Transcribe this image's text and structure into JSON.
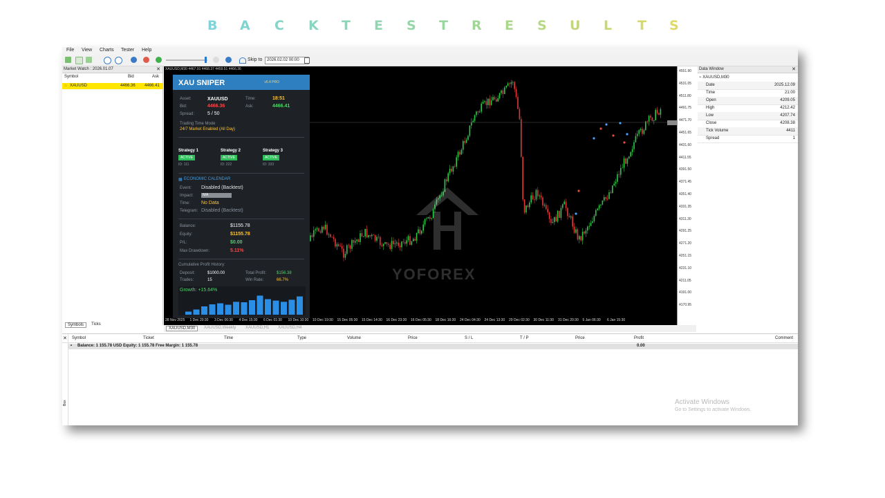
{
  "banner": {
    "letters": [
      "B",
      "A",
      "C",
      "K",
      "T",
      "E",
      "S",
      "T",
      "R",
      "E",
      "S",
      "U",
      "L",
      "T",
      "S"
    ],
    "colors": [
      "#7ed4d9",
      "#80d4d0",
      "#84d5c8",
      "#88d5c0",
      "#8cd6b8",
      "#91d6b0",
      "#95d6a8",
      "#9ad6a0",
      "#a2d696",
      "#acd68c",
      "#b6d783",
      "#c1d77a",
      "#cbd772",
      "#d5d86b",
      "#dfd966"
    ]
  },
  "menu": [
    "File",
    "View",
    "Charts",
    "Tester",
    "Help"
  ],
  "toolbar": {
    "skip_label": "Skip to",
    "skip_value": "2026.02.02 00:00"
  },
  "market_watch": {
    "title": "Market Watch : 2026.01.07",
    "columns": [
      "Symbol",
      "Bid",
      "Ask"
    ],
    "row": {
      "symbol": "XAUUSD",
      "bid": "4466.36",
      "ask": "4466.41"
    },
    "tabs": [
      "Symbols",
      "Ticks"
    ]
  },
  "chart": {
    "header": "XAUUSD,M30  4467.91 4468.37 4459.51 4466.36",
    "y_labels": [
      "4551.90",
      "4531.05",
      "4511.80",
      "4491.75",
      "4471.70",
      "4451.65",
      "4431.60",
      "4411.55",
      "4391.50",
      "4371.45",
      "4351.40",
      "4331.35",
      "4311.30",
      "4291.25",
      "4271.20",
      "4251.15",
      "4231.10",
      "4211.05",
      "4191.00",
      "4170.95"
    ],
    "x_labels": [
      "28 Nov 2025",
      "1 Dec 20:30",
      "3 Dec 06:30",
      "4 Dec 15:30",
      "6 Dec 01:30",
      "10 Dec 10:30",
      "10 Dec 19:30",
      "15 Dec 05:30",
      "15 Dec 14:30",
      "16 Dec 23:30",
      "16 Dec 05:30",
      "18 Dec 16:30",
      "24 Dec 04:30",
      "24 Dec 13:30",
      "29 Dec 02:30",
      "30 Dec 11:30",
      "31 Dec 20:30",
      "5 Jan 06:30",
      "6 Jan 15:30"
    ],
    "current_price": "4466.36",
    "tabs": [
      "XAUUSD,M30",
      "XAUUSD,Weekly",
      "XAUUSD,H1",
      "XAUUSD,H4"
    ],
    "watermark": "YOFOREX"
  },
  "ea": {
    "title": "XAU SNIPER",
    "version": "v5.4 PRO",
    "asset_label": "Asset:",
    "asset": "XAUUSD",
    "time_label": "Time:",
    "time": "18:51",
    "bid_label": "Bid:",
    "bid": "4466.36",
    "ask_label": "Ask:",
    "ask": "4466.41",
    "spread_label": "Spread:",
    "spread": "5 / 50",
    "mode_label": "Trading Time Mode",
    "mode": "24/7 Market Enabled (All Day)",
    "strategies": [
      {
        "name": "Strategy 1",
        "status": "ACTIVE",
        "id": "ID: 111"
      },
      {
        "name": "Strategy 2",
        "status": "ACTIVE",
        "id": "ID: 222"
      },
      {
        "name": "Strategy 3",
        "status": "ACTIVE",
        "id": "ID: 333"
      }
    ],
    "calendar_title": "ECONOMIC CALENDAR",
    "event_label": "Event:",
    "event": "Disabled (Backtest)",
    "impact_label": "Impact:",
    "impact": "N/A",
    "time2_label": "Time:",
    "time2": "No Data",
    "telegram_label": "Telegram:",
    "telegram": "Disabled (Backtest)",
    "balance_label": "Balance:",
    "balance": "$1155.78",
    "equity_label": "Equity:",
    "equity": "$1155.78",
    "pl_label": "P/L:",
    "pl": "$0.00",
    "dd_label": "Max Drawdown:",
    "dd": "5.11%",
    "history_title": "Cumulative Profit History:",
    "deposit_label": "Deposit:",
    "deposit": "$1000.00",
    "total_label": "Total Profit:",
    "total": "$156.38",
    "trades_label": "Trades:",
    "trades": "15",
    "winrate_label": "Win Rate:",
    "winrate": "66.7%",
    "growth": "Growth: +15.64%",
    "growth_bars": [
      0.15,
      0.25,
      0.4,
      0.5,
      0.55,
      0.48,
      0.62,
      0.6,
      0.7,
      0.92,
      0.75,
      0.68,
      0.62,
      0.72,
      0.88
    ]
  },
  "data_window": {
    "title": "Data Window",
    "symbol": "XAUUSD,M30",
    "rows": [
      {
        "k": "Date",
        "v": "2025.12.09"
      },
      {
        "k": "Time",
        "v": "21:00"
      },
      {
        "k": "Open",
        "v": "4209.05"
      },
      {
        "k": "High",
        "v": "4212.42"
      },
      {
        "k": "Low",
        "v": "4207.74"
      },
      {
        "k": "Close",
        "v": "4208.38"
      },
      {
        "k": "Tick Volume",
        "v": "4411"
      },
      {
        "k": "Spread",
        "v": "1"
      }
    ]
  },
  "terminal": {
    "columns": [
      "Symbol",
      "Ticket",
      "Time",
      "Type",
      "Volume",
      "Price",
      "S / L",
      "T / P",
      "Price",
      "Profit",
      "Comment"
    ],
    "balance_line": "Balance: 1 155.78 USD  Equity: 1 155.78  Free Margin: 1 155.78",
    "profit": "0.00",
    "side_label": "Box"
  },
  "watermark": {
    "line1": "Activate Windows",
    "line2": "Go to Settings to activate Windows."
  }
}
